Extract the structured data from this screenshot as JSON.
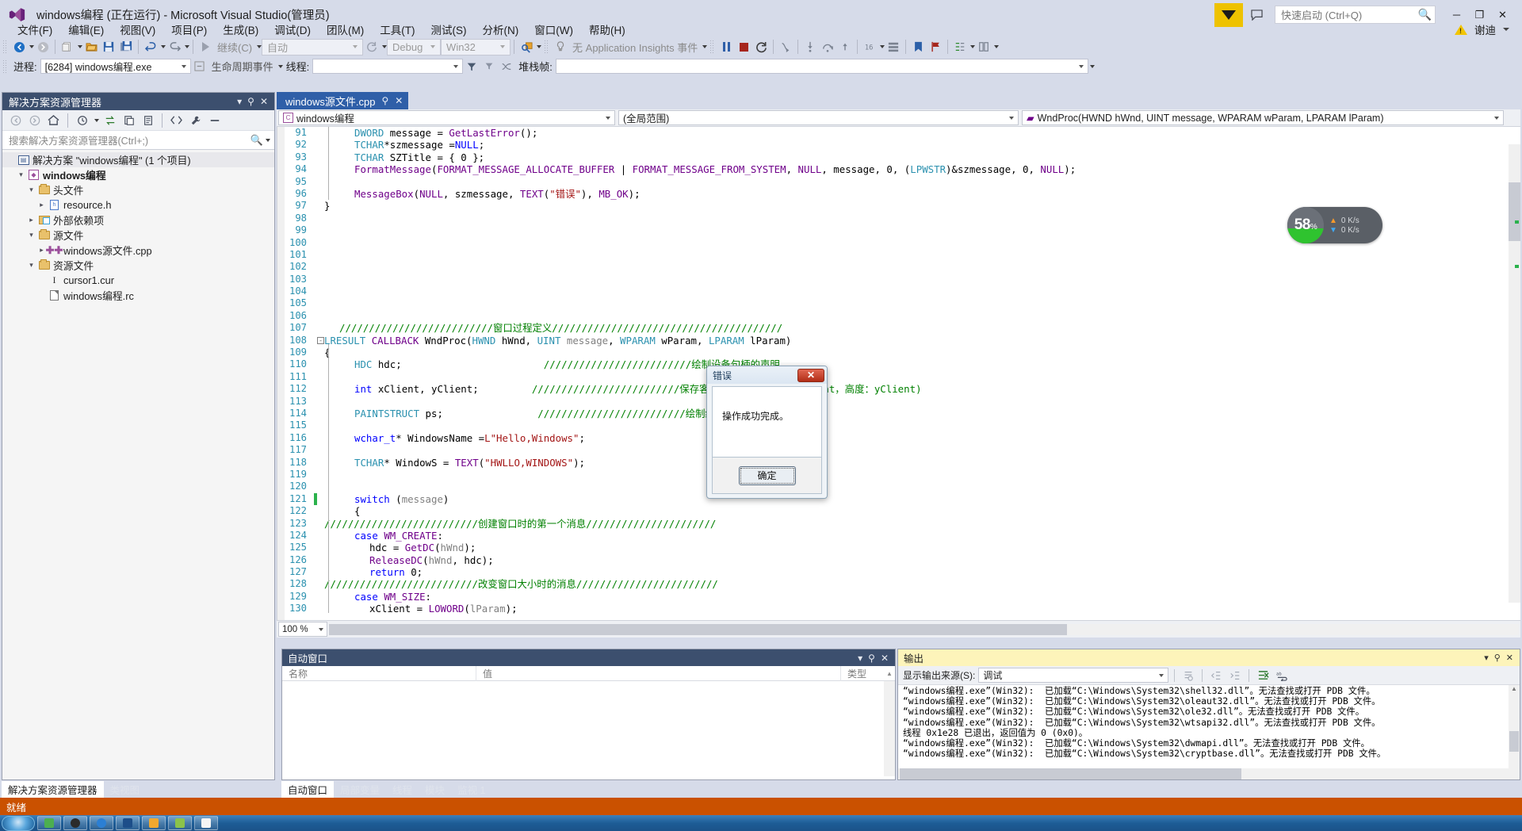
{
  "window": {
    "title": "windows编程 (正在运行) - Microsoft Visual Studio(管理员)",
    "logo_icon": "visual-studio-logo",
    "minimize": "─",
    "maximize": "❐",
    "close": "✕"
  },
  "quick_launch": {
    "placeholder": "快速启动 (Ctrl+Q)",
    "icon": "search-icon"
  },
  "titlebar_right": {
    "feedback_icon": "feedback-flag-icon",
    "comment_icon": "speech-bubble-icon",
    "warning_icon": "warning-icon",
    "user": "谢迪"
  },
  "menu": [
    "文件(F)",
    "编辑(E)",
    "视图(V)",
    "项目(P)",
    "生成(B)",
    "调试(D)",
    "团队(M)",
    "工具(T)",
    "测试(S)",
    "分析(N)",
    "窗口(W)",
    "帮助(H)"
  ],
  "toolbar1": {
    "back_icon": "navigate-back-icon",
    "forward_icon": "navigate-forward-icon",
    "new_icon": "new-item-icon",
    "open_icon": "open-file-icon",
    "save_icon": "save-icon",
    "save_all_icon": "save-all-icon",
    "undo_icon": "undo-icon",
    "redo_icon": "redo-icon",
    "continue_label": "继续(C)",
    "auto_combo": "自动",
    "restart_icon": "restart-icon",
    "config_combo": "Debug",
    "platform_combo": "Win32",
    "find_icon": "find-in-files-icon",
    "app_insights": "无 Application Insights 事件",
    "pause_icon": "pause-icon",
    "stop_icon": "stop-icon",
    "restart_debug_icon": "restart-debug-icon",
    "show_next_icon": "show-next-statement-icon",
    "step_into_icon": "step-into-icon",
    "step_over_icon": "step-over-icon",
    "step_out_icon": "step-out-icon",
    "hex_icon": "hex-display-icon",
    "thread_icon": "threads-icon",
    "bookmark_icon": "bookmark-icon",
    "flag_icon": "flag-icon",
    "cmp_icon": "compare-icon",
    "col_icon": "column-icon"
  },
  "toolbar2": {
    "process_label": "进程:",
    "process_value": "[6284] windows编程.exe",
    "lifecycle_label": "生命周期事件",
    "thread_label": "线程:",
    "thread_value": "",
    "stackframe_label": "堆栈帧:",
    "stackframe_value": "",
    "filter_icon": "filter-icon",
    "clear_filter_icon": "clear-filter-icon",
    "cross_icon": "cross-thread-icon"
  },
  "solution_explorer": {
    "title": "解决方案资源管理器",
    "actions": {
      "dropdown": "▾",
      "pin": "⚲",
      "close": "✕"
    },
    "toolbar_icons": [
      "navigate-back-icon",
      "navigate-forward-icon",
      "home-icon",
      "pending-changes-icon",
      "sync-with-active-doc-icon",
      "refresh-icon",
      "show-all-files-icon",
      "collapse-all-icon",
      "code-view-icon",
      "properties-icon",
      "collapse-icon"
    ],
    "search_placeholder": "搜索解决方案资源管理器(Ctrl+;)",
    "search_icon": "search-icon",
    "tree": [
      {
        "label": "解决方案 \"windows编程\"  (1 个项目)",
        "icon": "solution-icon",
        "indent": 0,
        "twist": "",
        "bold": false,
        "selected": true
      },
      {
        "label": "windows编程",
        "icon": "project-icon",
        "indent": 1,
        "twist": "▲",
        "bold": true,
        "selected": false
      },
      {
        "label": "头文件",
        "icon": "folder-icon",
        "indent": 2,
        "twist": "▲",
        "bold": false,
        "selected": false
      },
      {
        "label": "resource.h",
        "icon": "header-file-icon",
        "indent": 3,
        "twist": "▶",
        "bold": false,
        "selected": false
      },
      {
        "label": "外部依赖项",
        "icon": "external-deps-icon",
        "indent": 2,
        "twist": "▶",
        "bold": false,
        "selected": false
      },
      {
        "label": "源文件",
        "icon": "folder-icon",
        "indent": 2,
        "twist": "▲",
        "bold": false,
        "selected": false
      },
      {
        "label": "windows源文件.cpp",
        "icon": "cpp-file-icon",
        "indent": 3,
        "twist": "▶",
        "bold": false,
        "selected": false
      },
      {
        "label": "资源文件",
        "icon": "folder-icon",
        "indent": 2,
        "twist": "▲",
        "bold": false,
        "selected": false
      },
      {
        "label": "cursor1.cur",
        "icon": "cursor-file-icon",
        "indent": 3,
        "twist": "",
        "bold": false,
        "selected": false
      },
      {
        "label": "windows编程.rc",
        "icon": "resource-file-icon",
        "indent": 3,
        "twist": "",
        "bold": false,
        "selected": false
      }
    ]
  },
  "editor": {
    "tab_label": "windows源文件.cpp",
    "tab_pin": "⚲",
    "tab_close": "✕",
    "project_combo": "windows编程",
    "scope_combo": "(全局范围)",
    "member_combo": "WndProc(HWND hWnd, UINT message, WPARAM wParam, LPARAM lParam)",
    "zoom_level": "100 %",
    "first_line": 91,
    "lines": [
      {
        "n": 91,
        "indent": 2,
        "changed": false,
        "fold": "",
        "segs": [
          [
            "DWORD ",
            "teal"
          ],
          [
            "message = ",
            "black"
          ],
          [
            "GetLastError",
            "purple"
          ],
          [
            "();",
            "black"
          ]
        ]
      },
      {
        "n": 92,
        "indent": 2,
        "changed": false,
        "fold": "",
        "segs": [
          [
            "TCHAR",
            "teal"
          ],
          [
            "*szmessage =",
            "black"
          ],
          [
            "NULL",
            "blue"
          ],
          [
            ";",
            "black"
          ]
        ]
      },
      {
        "n": 93,
        "indent": 2,
        "changed": false,
        "fold": "",
        "segs": [
          [
            "TCHAR",
            "teal"
          ],
          [
            " SZTitle = { 0 };",
            "black"
          ]
        ]
      },
      {
        "n": 94,
        "indent": 2,
        "changed": false,
        "fold": "",
        "segs": [
          [
            "FormatMessage",
            "purple"
          ],
          [
            "(",
            "black"
          ],
          [
            "FORMAT_MESSAGE_ALLOCATE_BUFFER",
            "purple"
          ],
          [
            " | ",
            "black"
          ],
          [
            "FORMAT_MESSAGE_FROM_SYSTEM",
            "purple"
          ],
          [
            ", ",
            "black"
          ],
          [
            "NULL",
            "purple"
          ],
          [
            ", message, 0, (",
            "black"
          ],
          [
            "LPWSTR",
            "teal"
          ],
          [
            ")&szmessage, 0, ",
            "black"
          ],
          [
            "NULL",
            "purple"
          ],
          [
            ");",
            "black"
          ]
        ]
      },
      {
        "n": 95,
        "indent": 0,
        "changed": false,
        "fold": "",
        "segs": []
      },
      {
        "n": 96,
        "indent": 2,
        "changed": false,
        "fold": "",
        "segs": [
          [
            "MessageBox",
            "purple"
          ],
          [
            "(",
            "black"
          ],
          [
            "NULL",
            "purple"
          ],
          [
            ", szmessage, ",
            "black"
          ],
          [
            "TEXT",
            "purple"
          ],
          [
            "(",
            "black"
          ],
          [
            "\"错误\"",
            "red"
          ],
          [
            "), ",
            "black"
          ],
          [
            "MB_OK",
            "purple"
          ],
          [
            ");",
            "black"
          ]
        ]
      },
      {
        "n": 97,
        "indent": 0,
        "changed": false,
        "fold": "",
        "segs": [
          [
            "}",
            "black"
          ]
        ]
      },
      {
        "n": 98,
        "indent": 0,
        "changed": false,
        "fold": "",
        "segs": []
      },
      {
        "n": 99,
        "indent": 0,
        "changed": false,
        "fold": "",
        "segs": []
      },
      {
        "n": 100,
        "indent": 0,
        "changed": false,
        "fold": "",
        "segs": []
      },
      {
        "n": 101,
        "indent": 0,
        "changed": false,
        "fold": "",
        "segs": []
      },
      {
        "n": 102,
        "indent": 0,
        "changed": false,
        "fold": "",
        "segs": []
      },
      {
        "n": 103,
        "indent": 0,
        "changed": false,
        "fold": "",
        "segs": []
      },
      {
        "n": 104,
        "indent": 0,
        "changed": false,
        "fold": "",
        "segs": []
      },
      {
        "n": 105,
        "indent": 0,
        "changed": false,
        "fold": "",
        "segs": []
      },
      {
        "n": 106,
        "indent": 0,
        "changed": false,
        "fold": "",
        "segs": []
      },
      {
        "n": 107,
        "indent": 1,
        "changed": false,
        "fold": "",
        "segs": [
          [
            "//////////////////////////窗口过程定义///////////////////////////////////////",
            "green"
          ]
        ]
      },
      {
        "n": 108,
        "indent": 0,
        "changed": false,
        "fold": "-",
        "segs": [
          [
            "LRESULT",
            "teal"
          ],
          [
            " ",
            "black"
          ],
          [
            "CALLBACK",
            "purple"
          ],
          [
            " WndProc(",
            "black"
          ],
          [
            "HWND",
            "teal"
          ],
          [
            " hWnd, ",
            "black"
          ],
          [
            "UINT",
            "teal"
          ],
          [
            " ",
            "black"
          ],
          [
            "message",
            "gray"
          ],
          [
            ", ",
            "black"
          ],
          [
            "WPARAM",
            "teal"
          ],
          [
            " wParam, ",
            "black"
          ],
          [
            "LPARAM",
            "teal"
          ],
          [
            " lParam)",
            "black"
          ]
        ]
      },
      {
        "n": 109,
        "indent": 0,
        "changed": false,
        "fold": "",
        "segs": [
          [
            "{",
            "black"
          ]
        ]
      },
      {
        "n": 110,
        "indent": 2,
        "changed": false,
        "fold": "",
        "segs": [
          [
            "HDC",
            "teal"
          ],
          [
            " hdc;                        ",
            "black"
          ],
          [
            "/////////////////////////绘制设备句柄的声明",
            "green"
          ]
        ]
      },
      {
        "n": 111,
        "indent": 0,
        "changed": false,
        "fold": "",
        "segs": []
      },
      {
        "n": 112,
        "indent": 2,
        "changed": false,
        "fold": "",
        "segs": [
          [
            "int",
            "blue"
          ],
          [
            " xClient, yClient;         ",
            "black"
          ],
          [
            "/////////////////////////保存客户区的大小(宽度：xClient，高度：yClient)",
            "green"
          ]
        ]
      },
      {
        "n": 113,
        "indent": 0,
        "changed": false,
        "fold": "",
        "segs": []
      },
      {
        "n": 114,
        "indent": 2,
        "changed": false,
        "fold": "",
        "segs": [
          [
            "PAINTSTRUCT",
            "teal"
          ],
          [
            " ps;                ",
            "black"
          ],
          [
            "/////////////////////////绘制结构体",
            "green"
          ]
        ]
      },
      {
        "n": 115,
        "indent": 0,
        "changed": false,
        "fold": "",
        "segs": []
      },
      {
        "n": 116,
        "indent": 2,
        "changed": false,
        "fold": "",
        "segs": [
          [
            "wchar_t",
            "blue"
          ],
          [
            "* WindowsName =",
            "black"
          ],
          [
            "L\"Hello,Windows\"",
            "red"
          ],
          [
            ";",
            "black"
          ]
        ]
      },
      {
        "n": 117,
        "indent": 0,
        "changed": false,
        "fold": "",
        "segs": []
      },
      {
        "n": 118,
        "indent": 2,
        "changed": false,
        "fold": "",
        "segs": [
          [
            "TCHAR",
            "teal"
          ],
          [
            "* WindowS = ",
            "black"
          ],
          [
            "TEXT",
            "purple"
          ],
          [
            "(",
            "black"
          ],
          [
            "\"HWLLO,WINDOWS\"",
            "red"
          ],
          [
            ");",
            "black"
          ]
        ]
      },
      {
        "n": 119,
        "indent": 0,
        "changed": false,
        "fold": "",
        "segs": []
      },
      {
        "n": 120,
        "indent": 0,
        "changed": false,
        "fold": "",
        "segs": []
      },
      {
        "n": 121,
        "indent": 2,
        "changed": true,
        "fold": "",
        "segs": [
          [
            "switch",
            "blue"
          ],
          [
            " (",
            "black"
          ],
          [
            "message",
            "gray"
          ],
          [
            ")",
            "black"
          ]
        ]
      },
      {
        "n": 122,
        "indent": 2,
        "changed": false,
        "fold": "",
        "segs": [
          [
            "{",
            "black"
          ]
        ]
      },
      {
        "n": 123,
        "indent": 0,
        "changed": false,
        "fold": "",
        "segs": [
          [
            "//////////////////////////创建窗口时的第一个消息//////////////////////",
            "green"
          ]
        ]
      },
      {
        "n": 124,
        "indent": 2,
        "changed": false,
        "fold": "",
        "segs": [
          [
            "case",
            "blue"
          ],
          [
            " ",
            "black"
          ],
          [
            "WM_CREATE",
            "purple"
          ],
          [
            ":",
            "black"
          ]
        ]
      },
      {
        "n": 125,
        "indent": 3,
        "changed": false,
        "fold": "",
        "segs": [
          [
            "hdc = ",
            "black"
          ],
          [
            "GetDC",
            "purple"
          ],
          [
            "(",
            "black"
          ],
          [
            "hWnd",
            "gray"
          ],
          [
            ");",
            "black"
          ]
        ]
      },
      {
        "n": 126,
        "indent": 3,
        "changed": false,
        "fold": "",
        "segs": [
          [
            "ReleaseDC",
            "purple"
          ],
          [
            "(",
            "black"
          ],
          [
            "hWnd",
            "gray"
          ],
          [
            ", hdc);",
            "black"
          ]
        ]
      },
      {
        "n": 127,
        "indent": 3,
        "changed": false,
        "fold": "",
        "segs": [
          [
            "return",
            "blue"
          ],
          [
            " 0;",
            "black"
          ]
        ]
      },
      {
        "n": 128,
        "indent": 0,
        "changed": false,
        "fold": "",
        "segs": [
          [
            "//////////////////////////改变窗口大小时的消息////////////////////////",
            "green"
          ]
        ]
      },
      {
        "n": 129,
        "indent": 2,
        "changed": false,
        "fold": "",
        "segs": [
          [
            "case",
            "blue"
          ],
          [
            " ",
            "black"
          ],
          [
            "WM_SIZE",
            "purple"
          ],
          [
            ":",
            "black"
          ]
        ]
      },
      {
        "n": 130,
        "indent": 3,
        "changed": false,
        "fold": "",
        "segs": [
          [
            "xClient = ",
            "black"
          ],
          [
            "LOWORD",
            "purple"
          ],
          [
            "(",
            "black"
          ],
          [
            "lParam",
            "gray"
          ],
          [
            ");",
            "black"
          ]
        ]
      }
    ]
  },
  "network_widget": {
    "percent": "58",
    "percent_unit": "%",
    "up_icon": "upload-arrow-icon",
    "up_value": "0 K/s",
    "down_icon": "download-arrow-icon",
    "down_value": "0 K/s"
  },
  "dialog": {
    "title": "错误",
    "close_label": "✕",
    "message": "操作成功完成。",
    "ok_button": "确定"
  },
  "autos_panel": {
    "title": "自动窗口",
    "actions": {
      "dropdown": "▾",
      "pin": "⚲",
      "close": "✕"
    },
    "columns": [
      "名称",
      "值",
      "类型"
    ],
    "rows": []
  },
  "output_panel": {
    "title": "输出",
    "actions": {
      "dropdown": "▾",
      "pin": "⚲",
      "close": "✕"
    },
    "source_label": "显示输出来源(S):",
    "source_value": "调试",
    "toolbar_icons": [
      "find-message-icon",
      "go-to-previous-icon",
      "go-to-next-icon",
      "clear-all-icon",
      "toggle-word-wrap-icon"
    ],
    "lines": [
      "“windows编程.exe”(Win32):  已加载“C:\\Windows\\System32\\shell32.dll”。无法查找或打开 PDB 文件。",
      "“windows编程.exe”(Win32):  已加载“C:\\Windows\\System32\\oleaut32.dll”。无法查找或打开 PDB 文件。",
      "“windows编程.exe”(Win32):  已加载“C:\\Windows\\System32\\ole32.dll”。无法查找或打开 PDB 文件。",
      "“windows编程.exe”(Win32):  已加载“C:\\Windows\\System32\\wtsapi32.dll”。无法查找或打开 PDB 文件。",
      "线程 0x1e28 已退出，返回值为 0 (0x0)。",
      "“windows编程.exe”(Win32):  已加载“C:\\Windows\\System32\\dwmapi.dll”。无法查找或打开 PDB 文件。",
      "“windows编程.exe”(Win32):  已加载“C:\\Windows\\System32\\cryptbase.dll”。无法查找或打开 PDB 文件。"
    ]
  },
  "bottom_tabs_left": [
    {
      "label": "解决方案资源管理器",
      "active": true
    },
    {
      "label": "类视图",
      "active": false
    }
  ],
  "bottom_tabs_right": [
    {
      "label": "自动窗口",
      "active": true
    },
    {
      "label": "局部变量",
      "active": false
    },
    {
      "label": "线程",
      "active": false
    },
    {
      "label": "模块",
      "active": false
    },
    {
      "label": "监视 1",
      "active": false
    }
  ],
  "status_bar": {
    "text": "就绪",
    "color": "#ca5100"
  }
}
